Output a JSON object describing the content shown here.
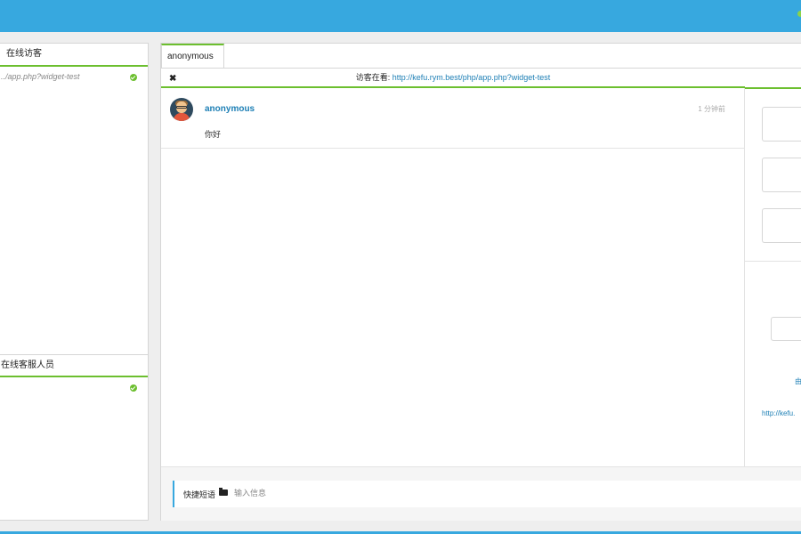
{
  "topbar": {
    "status_color": "#8bd34a",
    "brand_color": "#37a8df"
  },
  "visitors": {
    "header": "在线访客",
    "items": [
      {
        "url": "../app.php?widget-test",
        "online": true
      }
    ]
  },
  "staff": {
    "header": "在线客服人员",
    "items": [
      {
        "online": true
      }
    ]
  },
  "tab": {
    "label": "anonymous",
    "close_icon": "close-icon"
  },
  "viewing": {
    "prefix": "访客在看: ",
    "url": "http://kefu.rym.best/php/app.php?widget-test"
  },
  "messages": [
    {
      "name": "anonymous",
      "time": "1 分钟前",
      "text": "你好"
    }
  ],
  "composer": {
    "quick_label": "快捷短语",
    "placeholder": "输入信息"
  },
  "right_panel": {
    "link_short": "由",
    "link": "http://kefu."
  },
  "colors": {
    "accent_green": "#6cbf2f",
    "link_blue": "#1d7fb5"
  }
}
